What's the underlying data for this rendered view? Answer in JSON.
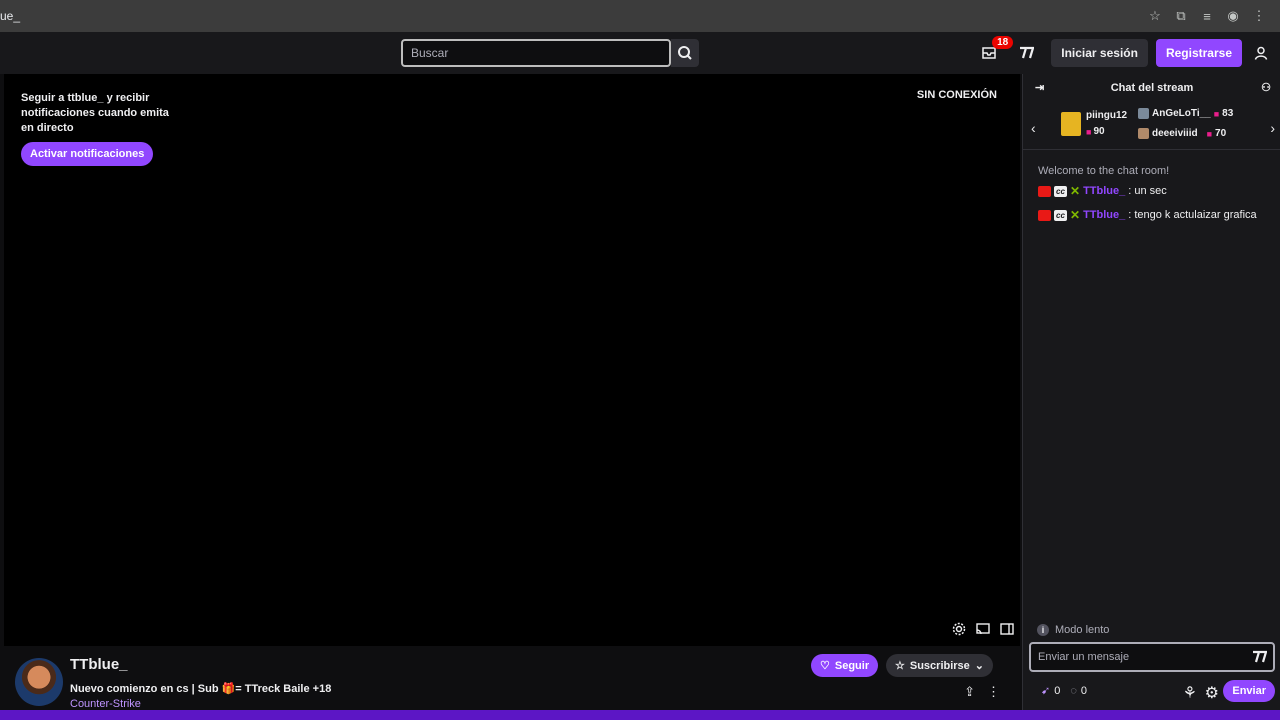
{
  "browser": {
    "url": "ue_"
  },
  "nav": {
    "search_placeholder": "Buscar",
    "inbox_count": "18",
    "login_label": "Iniciar sesión",
    "signup_label": "Registrarse"
  },
  "player": {
    "follow_prompt": "Seguir a ttblue_ y recibir notificaciones cuando emita en directo",
    "notify_label": "Activar notificaciones",
    "offline_label": "SIN CONEXIÓN"
  },
  "channel": {
    "name": "TTblue_",
    "title": "Nuevo comienzo en cs | Sub 🎁= TTreck Baile +18",
    "game": "Counter-Strike",
    "follow_label": "Seguir",
    "subscribe_label": "Suscribirse"
  },
  "chat": {
    "header": "Chat del stream",
    "gifters": [
      {
        "name": "piingu12",
        "count": "90"
      },
      {
        "name": "AnGeLoTi__",
        "count": "83"
      },
      {
        "name": "deeeiviiid",
        "count": "70"
      }
    ],
    "welcome": "Welcome to the chat room!",
    "messages": [
      {
        "user": "TTblue_",
        "text": ": un sec"
      },
      {
        "user": "TTblue_",
        "text": ": tengo k actulaizar grafica"
      }
    ],
    "slow_mode": "Modo lento",
    "input_placeholder": "Enviar un mensaje",
    "points_a": "0",
    "points_b": "0",
    "send_label": "Enviar"
  },
  "colors": {
    "accent": "#9147ff",
    "background": "#0e0e10",
    "panel": "#18181b",
    "badge": "#eb0400"
  }
}
